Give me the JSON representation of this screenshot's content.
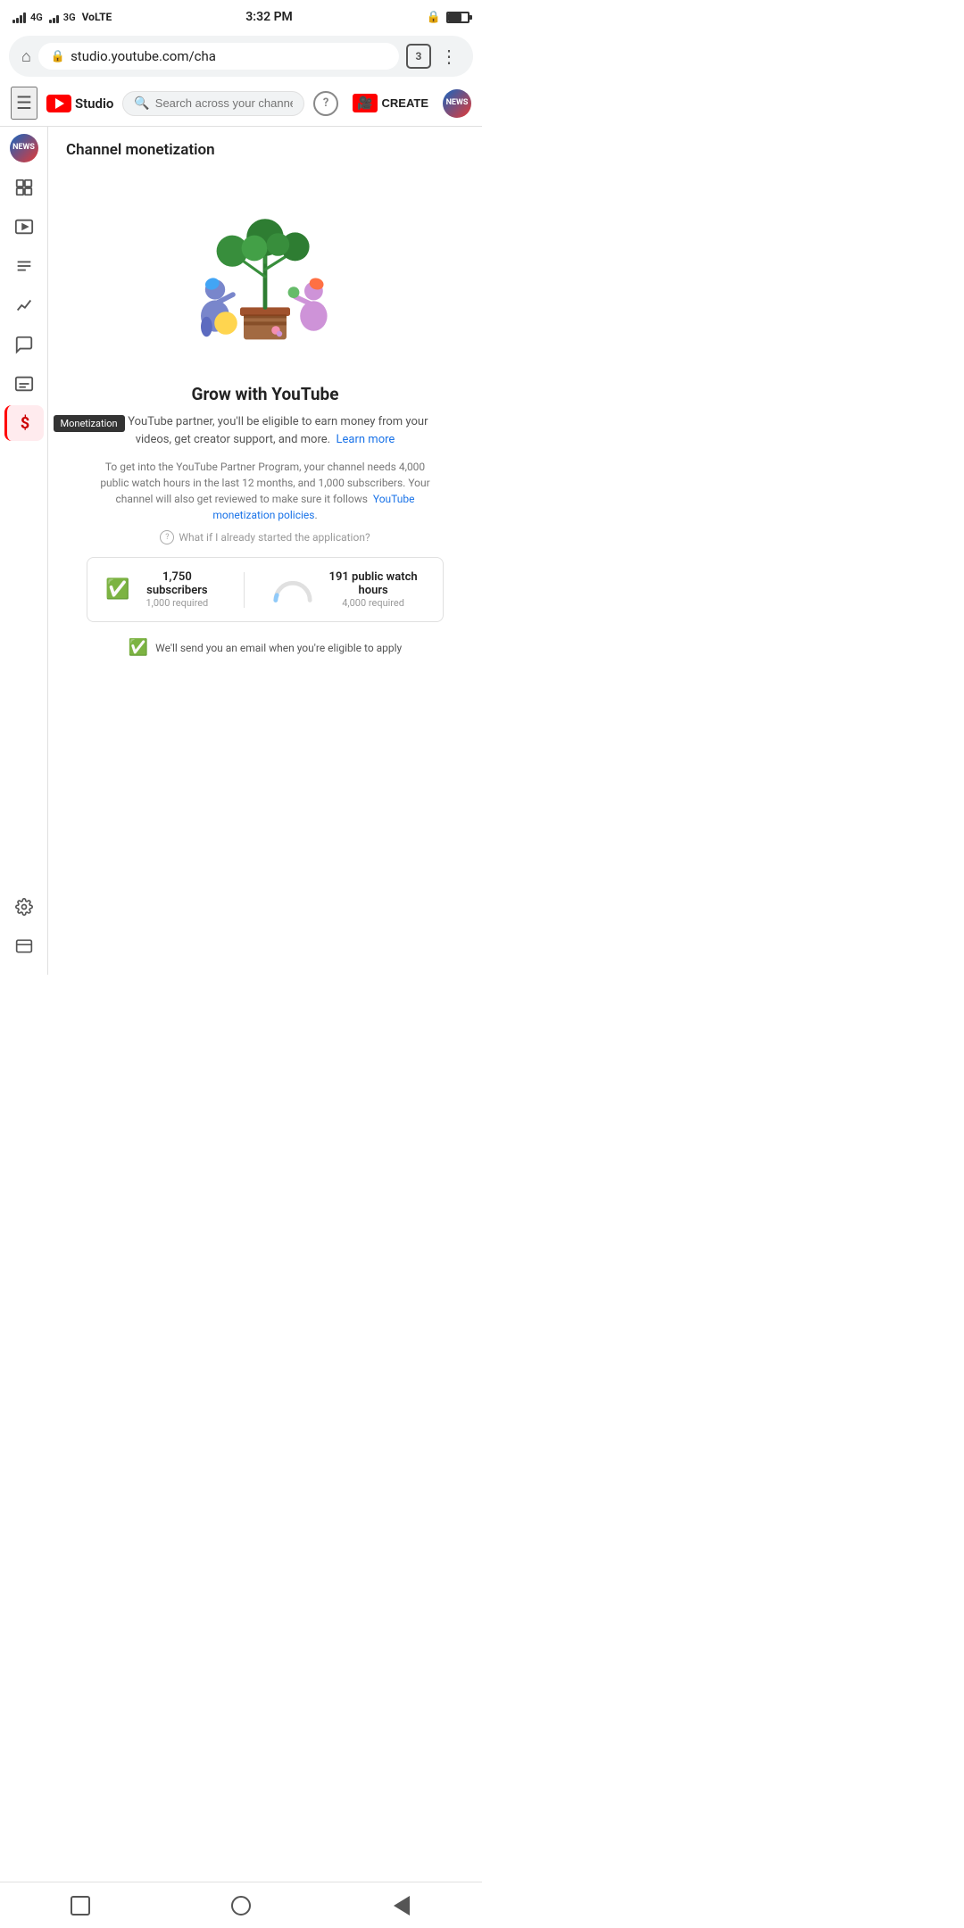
{
  "statusBar": {
    "network": "4G",
    "network2": "3G",
    "carrier": "VoLTE",
    "time": "3:32 PM",
    "lockIcon": "🔒",
    "tabCount": "3"
  },
  "browserBar": {
    "url": "studio.youtube.com/cha",
    "tabCount": "3",
    "homeIcon": "⌂",
    "moreIcon": "⋮"
  },
  "header": {
    "menuIcon": "☰",
    "logoText": "Studio",
    "searchPlaceholder": "Search across your channel",
    "helpLabel": "?",
    "createLabel": "CREATE",
    "avatarText": "NEWS"
  },
  "sidebar": {
    "items": [
      {
        "icon": "avatar",
        "label": "Channel",
        "name": "sidebar-item-channel"
      },
      {
        "icon": "grid",
        "label": "Dashboard",
        "name": "sidebar-item-dashboard"
      },
      {
        "icon": "video",
        "label": "Content",
        "name": "sidebar-item-content"
      },
      {
        "icon": "list",
        "label": "Playlists",
        "name": "sidebar-item-playlists"
      },
      {
        "icon": "analytics",
        "label": "Analytics",
        "name": "sidebar-item-analytics"
      },
      {
        "icon": "comments",
        "label": "Comments",
        "name": "sidebar-item-comments"
      },
      {
        "icon": "subtitles",
        "label": "Subtitles",
        "name": "sidebar-item-subtitles"
      },
      {
        "icon": "dollar",
        "label": "Monetization",
        "name": "sidebar-item-monetization",
        "active": true
      }
    ],
    "bottomItems": [
      {
        "icon": "gear",
        "label": "Settings",
        "name": "sidebar-item-settings"
      },
      {
        "icon": "feedback",
        "label": "Send Feedback",
        "name": "sidebar-item-feedback"
      }
    ],
    "tooltip": "Monetization"
  },
  "page": {
    "title": "Channel monetization"
  },
  "monetization": {
    "growTitle": "Grow with YouTube",
    "growDesc": "As a YouTube partner, you'll be eligible to earn money from your videos, get creator support, and more.",
    "learnMore": "Learn more",
    "partnerDesc": "To get into the YouTube Partner Program, your channel needs 4,000 public watch hours in the last 12 months, and 1,000 subscribers. Your channel will also get reviewed to make sure it follows",
    "monetizationPolicies": "YouTube monetization policies",
    "alreadyApplied": "What if I already started the application?",
    "subscribers": {
      "count": "1,750 subscribers",
      "required": "1,000 required"
    },
    "watchHours": {
      "count": "191 public watch hours",
      "required": "4,000 required"
    },
    "emailNotice": "We'll send you an email when you're eligible to apply"
  },
  "androidNav": {
    "squareLabel": "recent",
    "circleLabel": "home",
    "triangleLabel": "back"
  }
}
